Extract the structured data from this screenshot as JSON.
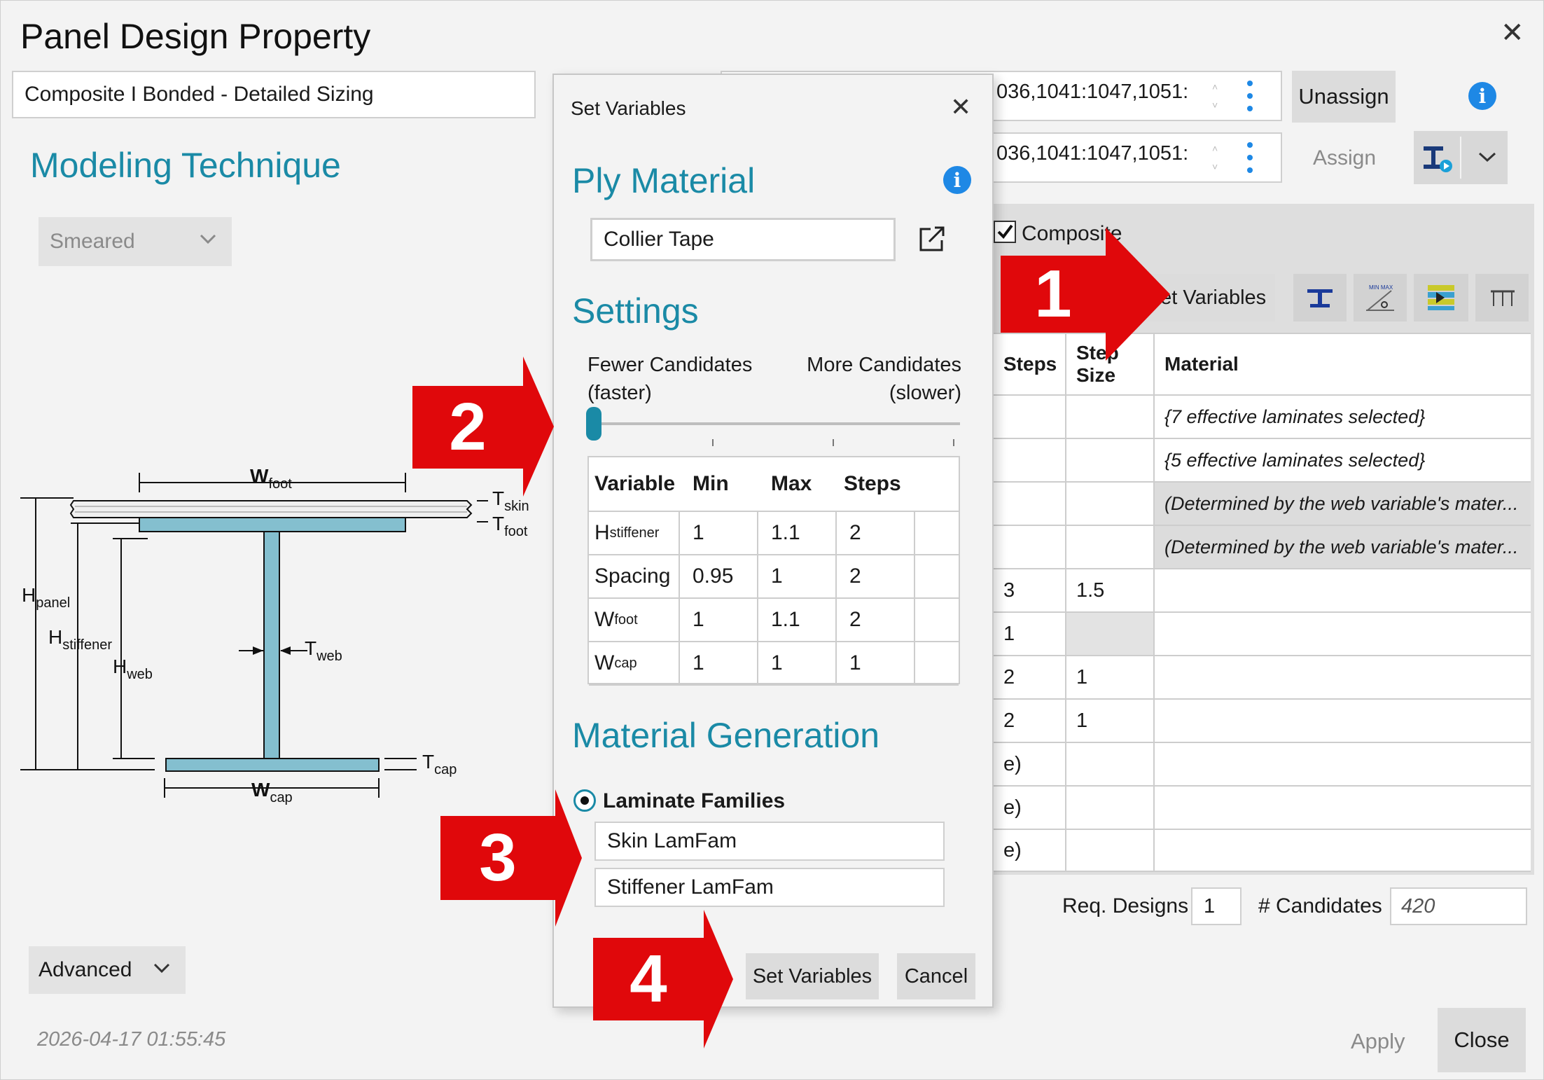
{
  "window": {
    "title": "Panel Design Property",
    "close_glyph": "✕"
  },
  "design_name": "Composite I Bonded - Detailed Sizing",
  "modeling_technique": {
    "heading": "Modeling Technique",
    "selected": "Smeared"
  },
  "diagram": {
    "labels": {
      "w_foot": "W",
      "w_foot_sub": "foot",
      "t_skin": "T",
      "t_skin_sub": "skin",
      "t_foot": "T",
      "t_foot_sub": "foot",
      "h_panel": "H",
      "h_panel_sub": "panel",
      "h_stiffener": "H",
      "h_stiffener_sub": "stiffener",
      "h_web": "H",
      "h_web_sub": "web",
      "t_web": "T",
      "t_web_sub": "web",
      "t_cap": "T",
      "t_cap_sub": "cap",
      "w_cap": "W",
      "w_cap_sub": "cap"
    }
  },
  "advanced_label": "Advanced",
  "timestamp": "2026-04-17 01:55:45",
  "assign_area": {
    "field1": "036,1041:1047,1051:",
    "field2": "036,1041:1047,1051:",
    "unassign_label": "Unassign",
    "assign_label": "Assign"
  },
  "composite_checkbox": {
    "label": "Composite",
    "checked": true
  },
  "toolbar": {
    "set_variables_label": "Set Variables"
  },
  "table": {
    "headers": {
      "steps": "Steps",
      "step_size_line1": "Step",
      "step_size_line2": "Size",
      "material": "Material"
    },
    "rows": [
      {
        "steps": "",
        "step_size": "",
        "material": "{7 effective laminates selected}",
        "material_gray": false,
        "row_gray": false
      },
      {
        "steps": "",
        "step_size": "",
        "material": "{5 effective laminates selected}",
        "material_gray": false,
        "row_gray": false
      },
      {
        "steps": "",
        "step_size": "",
        "material": "(Determined by the web variable's mater...",
        "material_gray": true,
        "row_gray": false
      },
      {
        "steps": "",
        "step_size": "",
        "material": "(Determined by the web variable's mater...",
        "material_gray": true,
        "row_gray": false
      },
      {
        "steps": "3",
        "step_size": "1.5",
        "material": "",
        "material_gray": false,
        "row_gray": false
      },
      {
        "steps": "1",
        "step_size": "",
        "material": "",
        "material_gray": false,
        "row_gray": true
      },
      {
        "steps": "2",
        "step_size": "1",
        "material": "",
        "material_gray": false,
        "row_gray": false
      },
      {
        "steps": "2",
        "step_size": "1",
        "material": "",
        "material_gray": false,
        "row_gray": false
      },
      {
        "steps": "e)",
        "step_size": "",
        "material": "",
        "material_gray": false,
        "row_gray": false
      },
      {
        "steps": "e)",
        "step_size": "",
        "material": "",
        "material_gray": false,
        "row_gray": false
      },
      {
        "steps": "e)",
        "step_size": "",
        "material": "",
        "material_gray": false,
        "row_gray": false
      }
    ]
  },
  "footer": {
    "req_designs_label": "Req. Designs",
    "req_designs_value": "1",
    "candidates_label": "# Candidates",
    "candidates_value": "420",
    "apply_label": "Apply",
    "close_label": "Close"
  },
  "set_variables_dialog": {
    "title": "Set Variables",
    "ply_material_heading": "Ply Material",
    "ply_material_value": "Collier Tape",
    "settings_heading": "Settings",
    "fewer_line1": "Fewer Candidates",
    "fewer_line2": "(faster)",
    "more_line1": "More Candidates",
    "more_line2": "(slower)",
    "slider_level": 0,
    "var_table": {
      "headers": [
        "Variable",
        "Min",
        "Max",
        "Steps"
      ],
      "rows": [
        {
          "name": "H",
          "sub": "stiffener",
          "min": "1",
          "max": "1.1",
          "steps": "2"
        },
        {
          "name": "Spacing",
          "sub": "",
          "min": "0.95",
          "max": "1",
          "steps": "2"
        },
        {
          "name": "W",
          "sub": "foot",
          "min": "1",
          "max": "1.1",
          "steps": "2"
        },
        {
          "name": "W",
          "sub": "cap",
          "min": "1",
          "max": "1",
          "steps": "1"
        }
      ]
    },
    "material_generation_heading": "Material Generation",
    "laminate_families_label": "Laminate Families",
    "families": [
      "Skin LamFam",
      "Stiffener LamFam"
    ],
    "ok_label": "Set Variables",
    "cancel_label": "Cancel"
  },
  "callouts": [
    "1",
    "2",
    "3",
    "4"
  ],
  "colors": {
    "accent_teal": "#1a8aa6",
    "callout_red": "#e0080b",
    "info_blue": "#1e88e5",
    "steel": "#84bfcf"
  }
}
